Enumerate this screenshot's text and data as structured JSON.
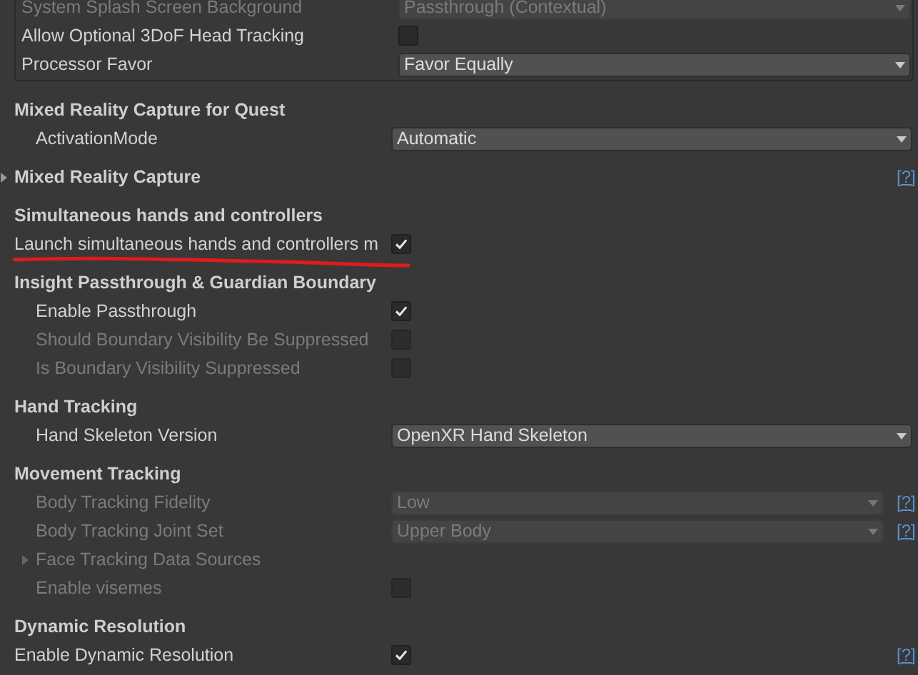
{
  "panel_rows": [
    {
      "kind": "dropdown",
      "label": "System Splash Screen Background",
      "value": "Passthrough (Contextual)",
      "disabled": true
    },
    {
      "kind": "checkbox",
      "label": "Allow Optional 3DoF Head Tracking",
      "checked": false,
      "disabled": false
    },
    {
      "kind": "dropdown",
      "label": "Processor Favor",
      "value": "Favor Equally",
      "disabled": false
    }
  ],
  "sections": [
    {
      "kind": "group",
      "title": "Mixed Reality Capture for Quest",
      "rows": [
        {
          "kind": "dropdown",
          "label": "ActivationMode",
          "value": "Automatic",
          "disabled": false,
          "indented": true
        }
      ]
    },
    {
      "kind": "foldout",
      "title": "Mixed Reality Capture",
      "expanded": false,
      "help": "[?]"
    },
    {
      "kind": "group",
      "title": "Simultaneous hands and controllers",
      "rows": [
        {
          "kind": "checkbox",
          "label": "Launch simultaneous hands and controllers m",
          "checked": true,
          "disabled": false,
          "indented": false,
          "underlined": true
        }
      ]
    },
    {
      "kind": "group",
      "title": "Insight Passthrough & Guardian Boundary",
      "rows": [
        {
          "kind": "checkbox",
          "label": "Enable Passthrough",
          "checked": true,
          "disabled": false,
          "indented": true
        },
        {
          "kind": "checkbox",
          "label": "Should Boundary Visibility Be Suppressed",
          "checked": false,
          "disabled": true,
          "indented": true
        },
        {
          "kind": "checkbox",
          "label": "Is Boundary Visibility Suppressed",
          "checked": false,
          "disabled": true,
          "indented": true
        }
      ]
    },
    {
      "kind": "group",
      "title": "Hand Tracking",
      "rows": [
        {
          "kind": "dropdown",
          "label": "Hand Skeleton Version",
          "value": "OpenXR Hand Skeleton",
          "disabled": false,
          "indented": true
        }
      ]
    },
    {
      "kind": "group",
      "title": "Movement Tracking",
      "rows": [
        {
          "kind": "dropdown",
          "label": "Body Tracking Fidelity",
          "value": "Low",
          "disabled": true,
          "indented": true,
          "help": "[?]"
        },
        {
          "kind": "dropdown",
          "label": "Body Tracking Joint Set",
          "value": "Upper Body",
          "disabled": true,
          "indented": true,
          "help": "[?]"
        },
        {
          "kind": "foldout",
          "label": "Face Tracking Data Sources",
          "expanded": false,
          "disabled": true,
          "indented": true
        },
        {
          "kind": "checkbox",
          "label": "Enable visemes",
          "checked": false,
          "disabled": true,
          "indented": true
        }
      ]
    },
    {
      "kind": "group",
      "title": "Dynamic Resolution",
      "rows": [
        {
          "kind": "checkbox",
          "label": "Enable Dynamic Resolution",
          "checked": true,
          "disabled": false,
          "indented": false,
          "help": "[?]"
        }
      ]
    }
  ]
}
